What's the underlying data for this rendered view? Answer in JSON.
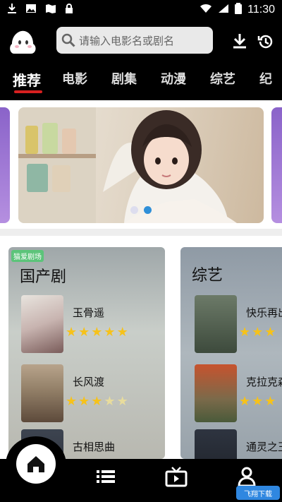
{
  "status_bar": {
    "time": "11:30",
    "icons": [
      "download-icon",
      "image-icon",
      "map-icon",
      "lock-icon",
      "wifi-icon",
      "signal-icon",
      "battery-icon"
    ]
  },
  "header": {
    "search_placeholder": "请输入电影名或剧名",
    "icons": [
      "logo-icon",
      "search-icon",
      "download-icon",
      "history-icon"
    ]
  },
  "tabs": [
    {
      "label": "推荐",
      "active": true
    },
    {
      "label": "电影",
      "active": false
    },
    {
      "label": "剧集",
      "active": false
    },
    {
      "label": "动漫",
      "active": false
    },
    {
      "label": "综艺",
      "active": false
    },
    {
      "label": "纪",
      "active": false
    }
  ],
  "banner": {
    "slides": 2,
    "current": 2
  },
  "sections": [
    {
      "badge": "猫爱剧场",
      "title": "国产剧",
      "items": [
        {
          "title": "玉骨遥",
          "rating": 5
        },
        {
          "title": "长风渡",
          "rating": 3.5
        },
        {
          "title": "古相思曲",
          "rating": null
        }
      ]
    },
    {
      "badge": "",
      "title": "综艺",
      "items": [
        {
          "title": "快乐再出",
          "rating": 3
        },
        {
          "title": "克拉克森",
          "rating": 3
        },
        {
          "title": "通灵之王",
          "rating": null
        }
      ]
    }
  ],
  "bottom_nav": [
    "home-icon",
    "list-icon",
    "tv-icon",
    "profile-icon"
  ],
  "watermark": "飞翔下载",
  "colors": {
    "accent": "#d62020",
    "star": "#f6c21a",
    "dot_active": "#2f8fd8"
  }
}
